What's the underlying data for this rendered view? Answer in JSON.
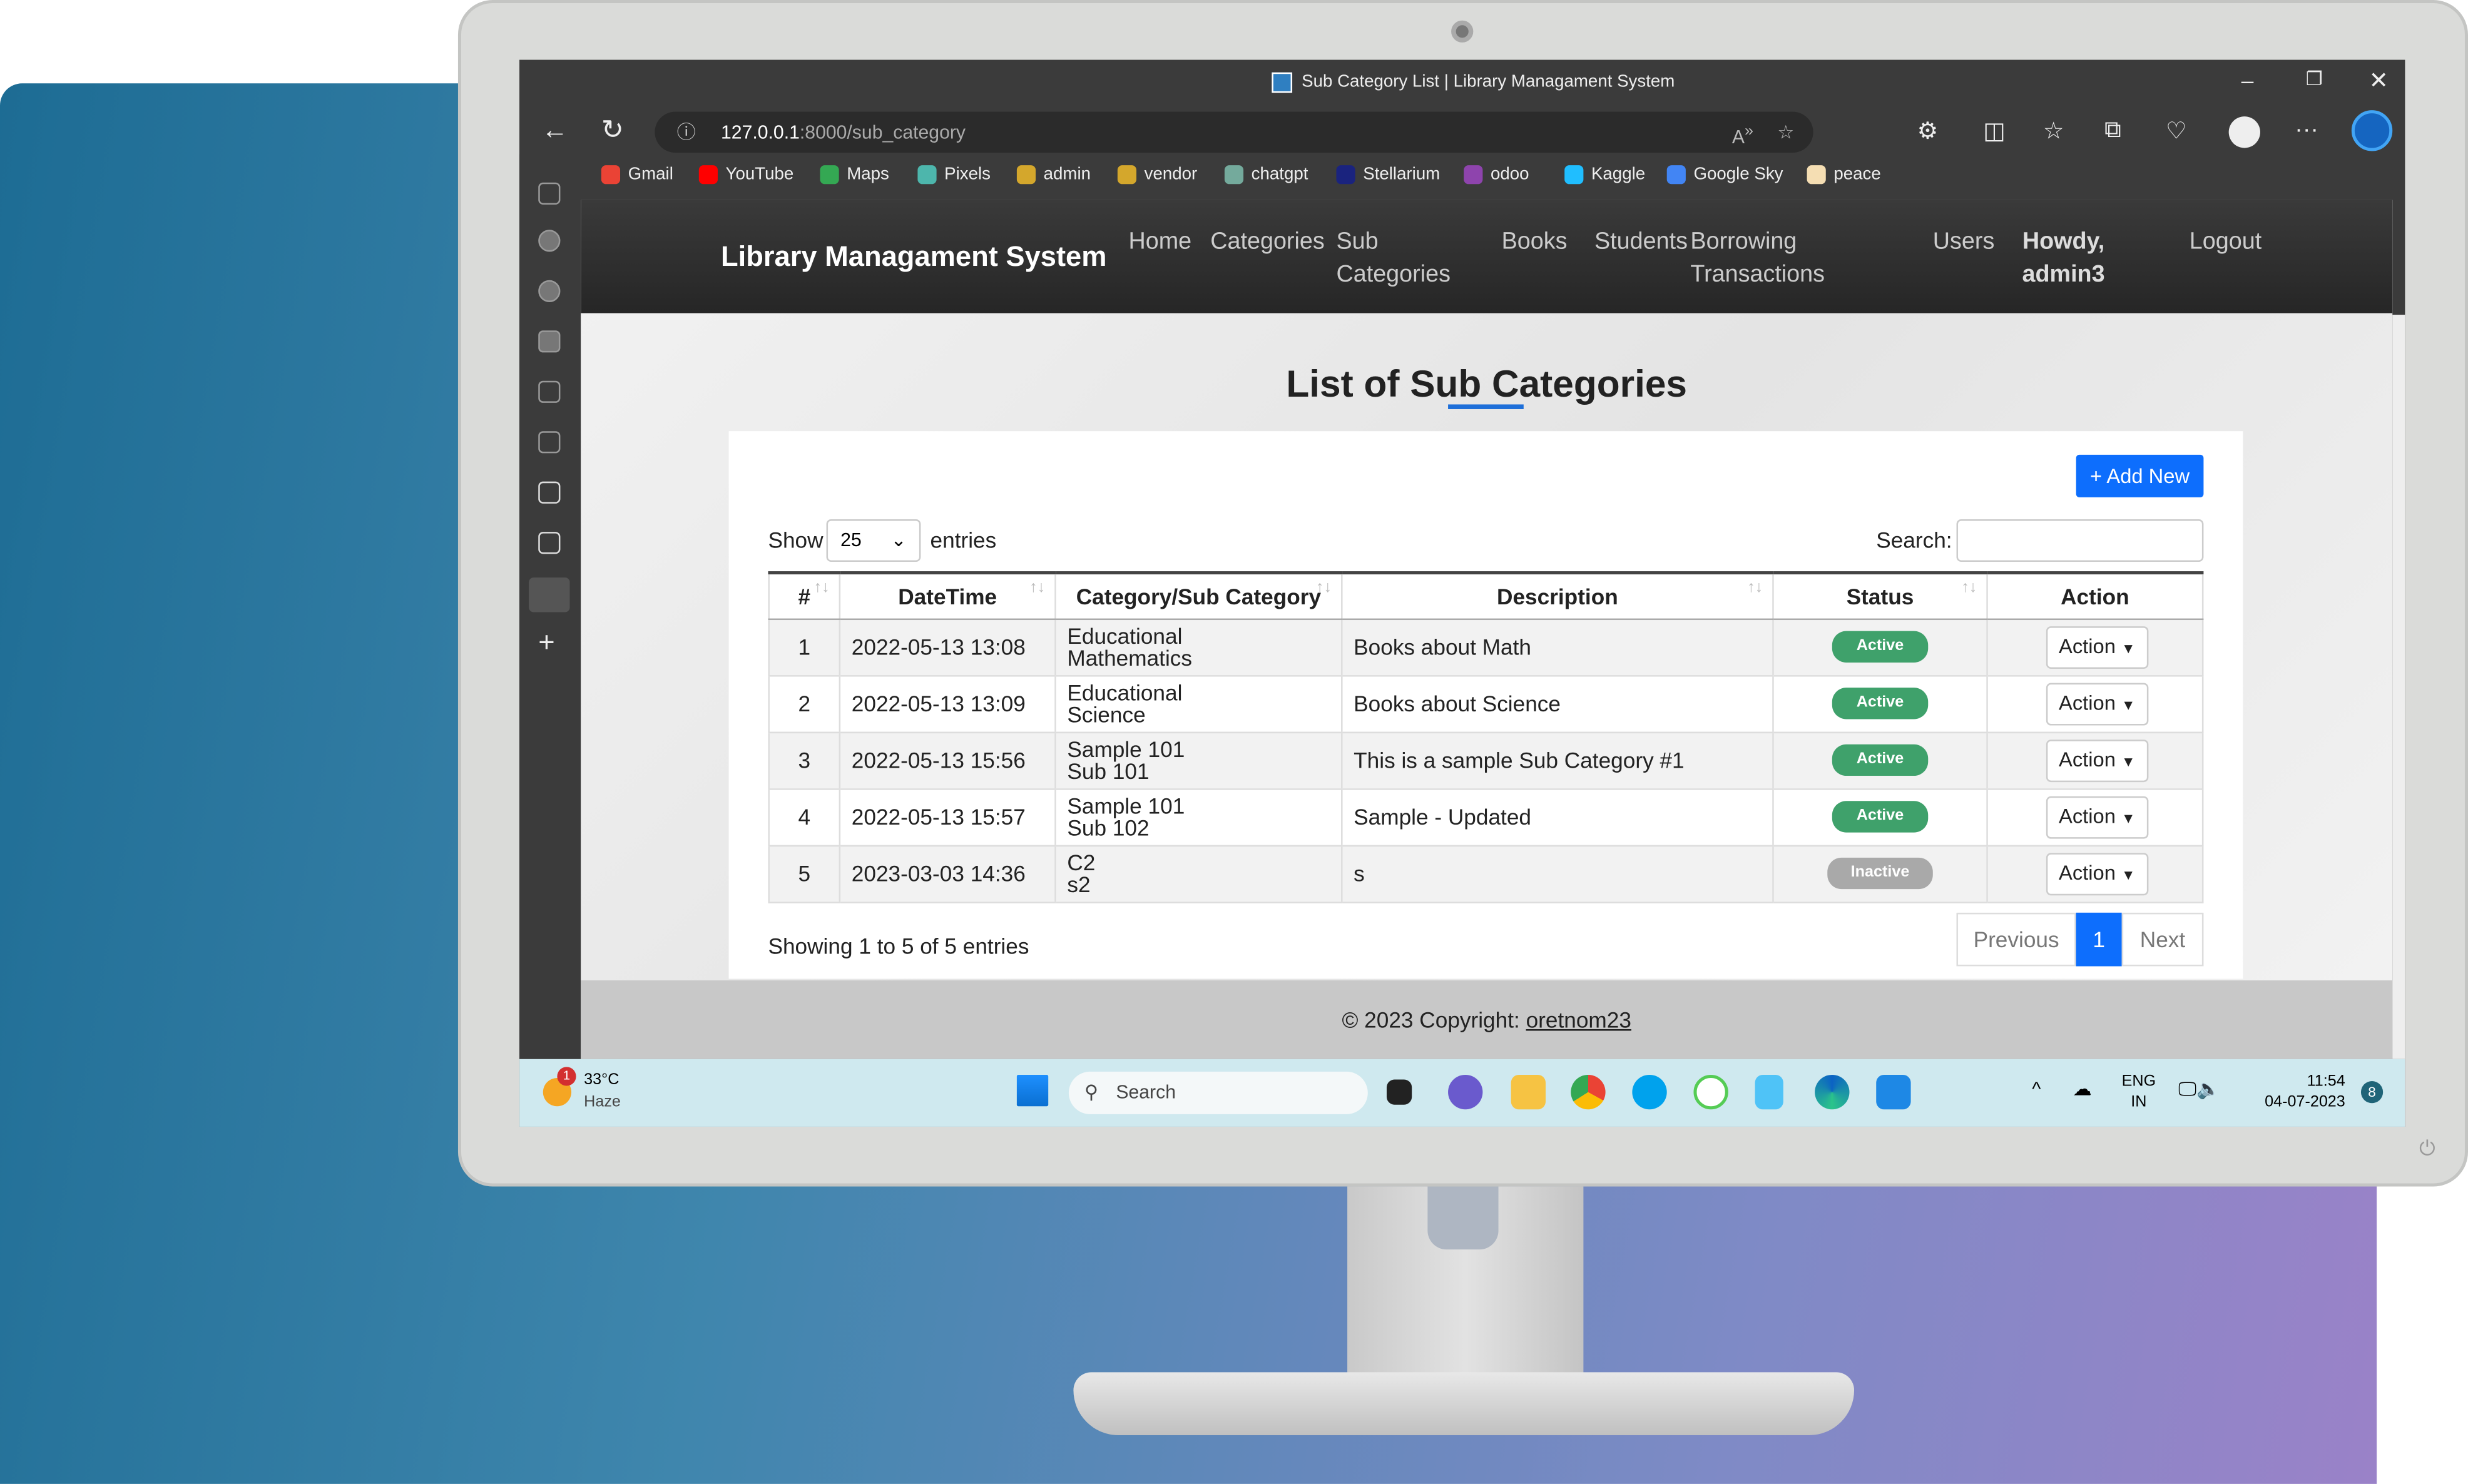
{
  "browser": {
    "tab_title": "Sub Category List | Library Managament System",
    "url_host": "127.0.0.1",
    "url_path": ":8000/sub_category",
    "bookmarks": [
      {
        "label": "Gmail",
        "color": "#ea4335"
      },
      {
        "label": "YouTube",
        "color": "#ff0000"
      },
      {
        "label": "Maps",
        "color": "#34a853"
      },
      {
        "label": "Pixels",
        "color": "#4db6ac"
      },
      {
        "label": "admin",
        "color": "#d4a72c"
      },
      {
        "label": "vendor",
        "color": "#d4a72c"
      },
      {
        "label": "chatgpt",
        "color": "#74aa9c"
      },
      {
        "label": "Stellarium",
        "color": "#1a237e"
      },
      {
        "label": "odoo",
        "color": "#8e44ad"
      },
      {
        "label": "Kaggle",
        "color": "#20beff"
      },
      {
        "label": "Google Sky",
        "color": "#4285f4"
      },
      {
        "label": "peace",
        "color": "#f5deb3"
      }
    ]
  },
  "navbar": {
    "brand": "Library Managament System",
    "links": [
      "Home",
      "Categories",
      "Sub Categories",
      "Books",
      "Students",
      "Borrowing Transactions",
      "Users"
    ],
    "greeting": "Howdy, admin3",
    "logout": "Logout"
  },
  "main": {
    "title": "List of Sub Categories",
    "add_new": "+ Add New",
    "show": "Show",
    "entries_value": "25",
    "entries": "entries",
    "search_label": "Search:",
    "search_value": "",
    "columns": [
      "#",
      "DateTime",
      "Category/Sub Category",
      "Description",
      "Status",
      "Action"
    ],
    "rows": [
      {
        "n": "1",
        "datetime": "2022-05-13 13:08",
        "category": "Educational",
        "sub": "Mathematics",
        "description": "Books about Math",
        "status": "Active",
        "action": "Action"
      },
      {
        "n": "2",
        "datetime": "2022-05-13 13:09",
        "category": "Educational",
        "sub": "Science",
        "description": "Books about Science",
        "status": "Active",
        "action": "Action"
      },
      {
        "n": "3",
        "datetime": "2022-05-13 15:56",
        "category": "Sample 101",
        "sub": "Sub 101",
        "description": "This is a sample Sub Category #1",
        "status": "Active",
        "action": "Action"
      },
      {
        "n": "4",
        "datetime": "2022-05-13 15:57",
        "category": "Sample 101",
        "sub": "Sub 102",
        "description": "Sample - Updated",
        "status": "Active",
        "action": "Action"
      },
      {
        "n": "5",
        "datetime": "2023-03-03 14:36",
        "category": "C2",
        "sub": "s2",
        "description": "s",
        "status": "Inactive",
        "action": "Action"
      }
    ],
    "info": "Showing 1 to 5 of 5 entries",
    "prev": "Previous",
    "page": "1",
    "next": "Next"
  },
  "status_colors": {
    "Active": "#3fa16b",
    "Inactive": "#a9a9a9"
  },
  "footer": {
    "text": "© 2023 Copyright: ",
    "link": "oretnom23"
  },
  "taskbar": {
    "temp": "33°C",
    "weather": "Haze",
    "weather_badge": "1",
    "search": "Search",
    "lang1": "ENG",
    "lang2": "IN",
    "time": "11:54",
    "date": "04-07-2023",
    "notif": "8"
  }
}
